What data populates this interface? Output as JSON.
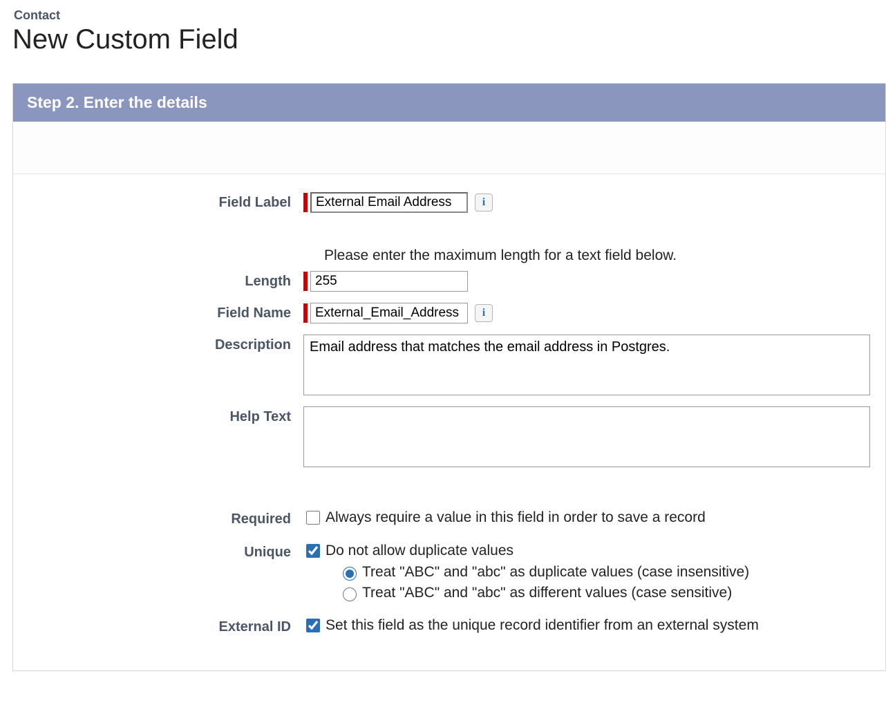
{
  "header": {
    "object": "Contact",
    "title": "New Custom Field"
  },
  "panel": {
    "step_title": "Step 2. Enter the details"
  },
  "form": {
    "field_label": {
      "label": "Field Label",
      "value": "External Email Address"
    },
    "length_instruction": "Please enter the maximum length for a text field below.",
    "length": {
      "label": "Length",
      "value": "255"
    },
    "field_name": {
      "label": "Field Name",
      "value": "External_Email_Address"
    },
    "description": {
      "label": "Description",
      "value": "Email address that matches the email address in Postgres."
    },
    "help_text": {
      "label": "Help Text",
      "value": ""
    },
    "required": {
      "label": "Required",
      "checked": false,
      "text": "Always require a value in this field in order to save a record"
    },
    "unique": {
      "label": "Unique",
      "checked": true,
      "text": "Do not allow duplicate values",
      "case_insensitive": {
        "selected": true,
        "text": "Treat \"ABC\" and \"abc\" as duplicate values (case insensitive)"
      },
      "case_sensitive": {
        "selected": false,
        "text": "Treat \"ABC\" and \"abc\" as different values (case sensitive)"
      }
    },
    "external_id": {
      "label": "External ID",
      "checked": true,
      "text": "Set this field as the unique record identifier from an external system"
    }
  },
  "icons": {
    "info": "i"
  }
}
